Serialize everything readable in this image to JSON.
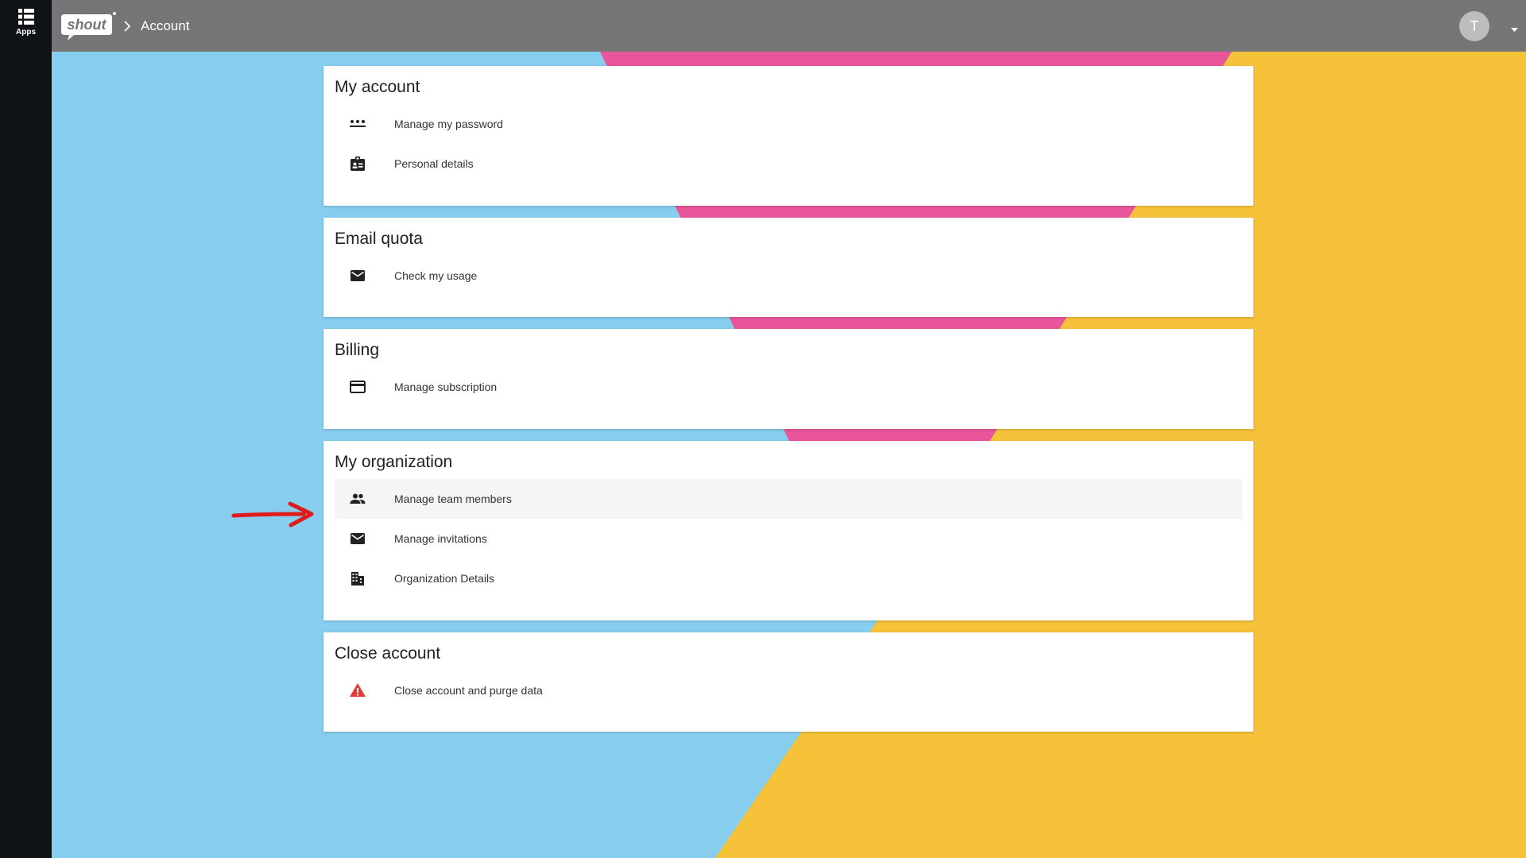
{
  "rail": {
    "apps_label": "Apps"
  },
  "topbar": {
    "logo_text": "shout",
    "breadcrumb": "Account",
    "avatar_initial": "T"
  },
  "sections": [
    {
      "title": "My account",
      "items": [
        {
          "icon": "password-dots-icon",
          "label": "Manage my password"
        },
        {
          "icon": "id-badge-icon",
          "label": "Personal details"
        }
      ]
    },
    {
      "title": "Email quota",
      "items": [
        {
          "icon": "mail-icon",
          "label": "Check my usage"
        }
      ]
    },
    {
      "title": "Billing",
      "items": [
        {
          "icon": "credit-card-icon",
          "label": "Manage subscription"
        }
      ]
    },
    {
      "title": "My organization",
      "items": [
        {
          "icon": "people-icon",
          "label": "Manage team members",
          "highlighted": true
        },
        {
          "icon": "mail-icon",
          "label": "Manage invitations"
        },
        {
          "icon": "building-icon",
          "label": "Organization Details"
        }
      ]
    },
    {
      "title": "Close account",
      "items": [
        {
          "icon": "warning-icon",
          "label": "Close account and purge data"
        }
      ]
    }
  ],
  "colors": {
    "rail": "#0f1317",
    "topbar": "#757575",
    "bg_blue": "#86cdee",
    "bg_pink": "#e8559a",
    "bg_yellow": "#f5c23a",
    "warning": "#e53935",
    "annotation_arrow": "#e01b1b"
  }
}
